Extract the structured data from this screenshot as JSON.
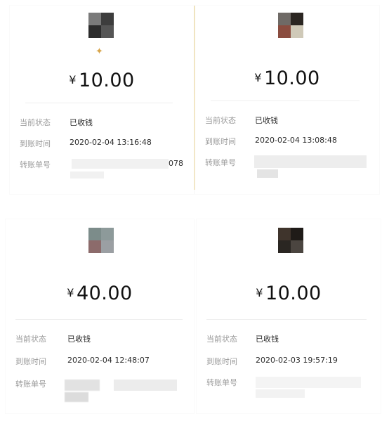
{
  "screenshots": [
    {
      "amount_currency": "¥",
      "amount_value": "10.00",
      "status_label": "当前状态",
      "status_value": "已收钱",
      "time_label": "到账时间",
      "time_value": "2020-02-04 13:16:48",
      "transfer_label": "转账单号",
      "transfer_value_suffix": "078",
      "avatar_icon": "blurred-avatar-icon",
      "badge_icon": "sparkle-icon"
    },
    {
      "amount_currency": "¥",
      "amount_value": "10.00",
      "status_label": "当前状态",
      "status_value": "已收钱",
      "time_label": "到账时间",
      "time_value": "2020-02-04 13:08:48",
      "transfer_label": "转账单号",
      "avatar_icon": "blurred-avatar-icon"
    },
    {
      "amount_currency": "¥",
      "amount_value": "40.00",
      "status_label": "当前状态",
      "status_value": "已收钱",
      "time_label": "到账时间",
      "time_value": "2020-02-04 12:48:07",
      "transfer_label": "转账单号",
      "avatar_icon": "blurred-avatar-icon"
    },
    {
      "amount_currency": "¥",
      "amount_value": "10.00",
      "status_label": "当前状态",
      "status_value": "已收钱",
      "time_label": "到账时间",
      "time_value": "2020-02-03 19:57:19",
      "transfer_label": "转账单号",
      "avatar_icon": "blurred-avatar-icon"
    }
  ],
  "colors": {
    "label_gray": "#9a9a9a",
    "value_dark": "#2a2a2a",
    "amount_black": "#111111",
    "divider_gold": "#f1e3b5"
  }
}
